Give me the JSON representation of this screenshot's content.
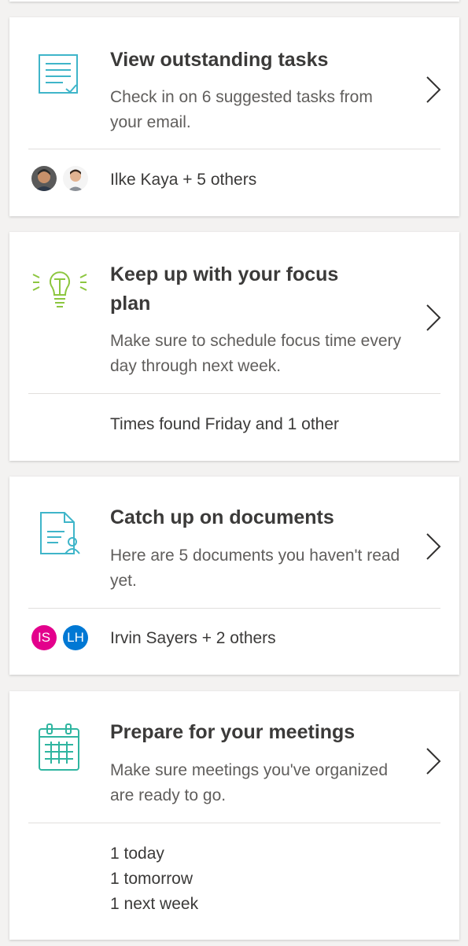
{
  "cards": [
    {
      "title": "View outstanding tasks",
      "description": "Check in on 6 suggested tasks from your email.",
      "footer": "Ilke Kaya + 5 others",
      "icon": "task-document-icon"
    },
    {
      "title": "Keep up with your focus plan",
      "description": "Make sure to schedule focus time every day through next week.",
      "footer": "Times found Friday and 1 other",
      "icon": "lightbulb-icon"
    },
    {
      "title": "Catch up on documents",
      "description": "Here are 5 documents you haven't read yet.",
      "footer": "Irvin Sayers + 2 others",
      "icon": "shared-document-icon",
      "avatars": [
        {
          "initials": "IS",
          "color": "#e3008c"
        },
        {
          "initials": "LH",
          "color": "#0078d4"
        }
      ]
    },
    {
      "title": "Prepare for your meetings",
      "description": "Make sure meetings you've organized are ready to go.",
      "footer_lines": [
        "1 today",
        "1 tomorrow",
        "1 next week"
      ],
      "icon": "calendar-icon"
    }
  ],
  "colors": {
    "accent_teal": "#3fb5c9",
    "accent_green": "#8cc63f",
    "calendar_teal": "#2fb5a0"
  }
}
